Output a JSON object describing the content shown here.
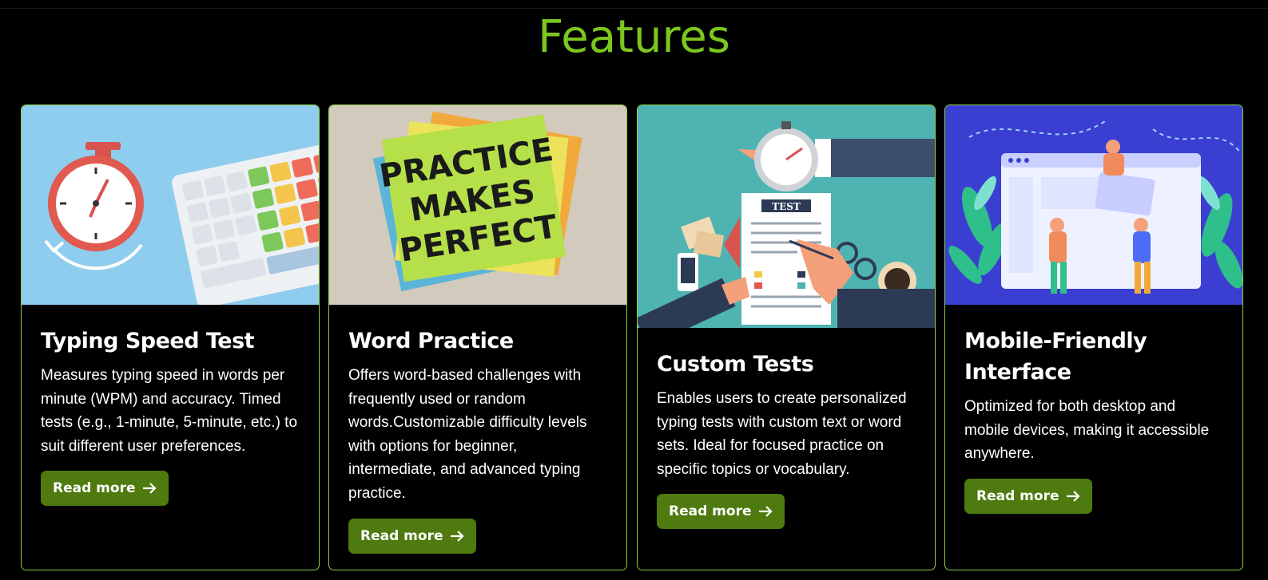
{
  "section": {
    "title": "Features"
  },
  "colors": {
    "accent": "#7cc61f",
    "card_border": "#8fd13f",
    "button_bg": "#4e7a10",
    "background": "#000000"
  },
  "cards": [
    {
      "title": "Typing Speed Test",
      "text": "Measures typing speed in words per minute (WPM) and accuracy. Timed tests (e.g., 1-minute, 5-minute, etc.) to suit different user preferences.",
      "button_label": "Read more",
      "image_icon": "stopwatch-keyboard-illustration"
    },
    {
      "title": "Word Practice",
      "text": "Offers word-based challenges with frequently used or random words.Customizable difficulty levels with options for beginner, intermediate, and advanced typing practice.",
      "button_label": "Read more",
      "image_icon": "sticky-notes-illustration",
      "image_text": [
        "PRACTICE",
        "MAKES",
        "PERFECT"
      ]
    },
    {
      "title": "Custom Tests",
      "text": "Enables users to create personalized typing tests with custom text or word sets. Ideal for focused practice on specific topics or vocabulary.",
      "button_label": "Read more",
      "image_icon": "test-paper-illustration",
      "image_text": "TEST"
    },
    {
      "title": "Mobile-Friendly Interface",
      "text": "Optimized for both desktop and mobile devices, making it accessible anywhere.",
      "button_label": "Read more",
      "image_icon": "responsive-web-illustration"
    }
  ]
}
